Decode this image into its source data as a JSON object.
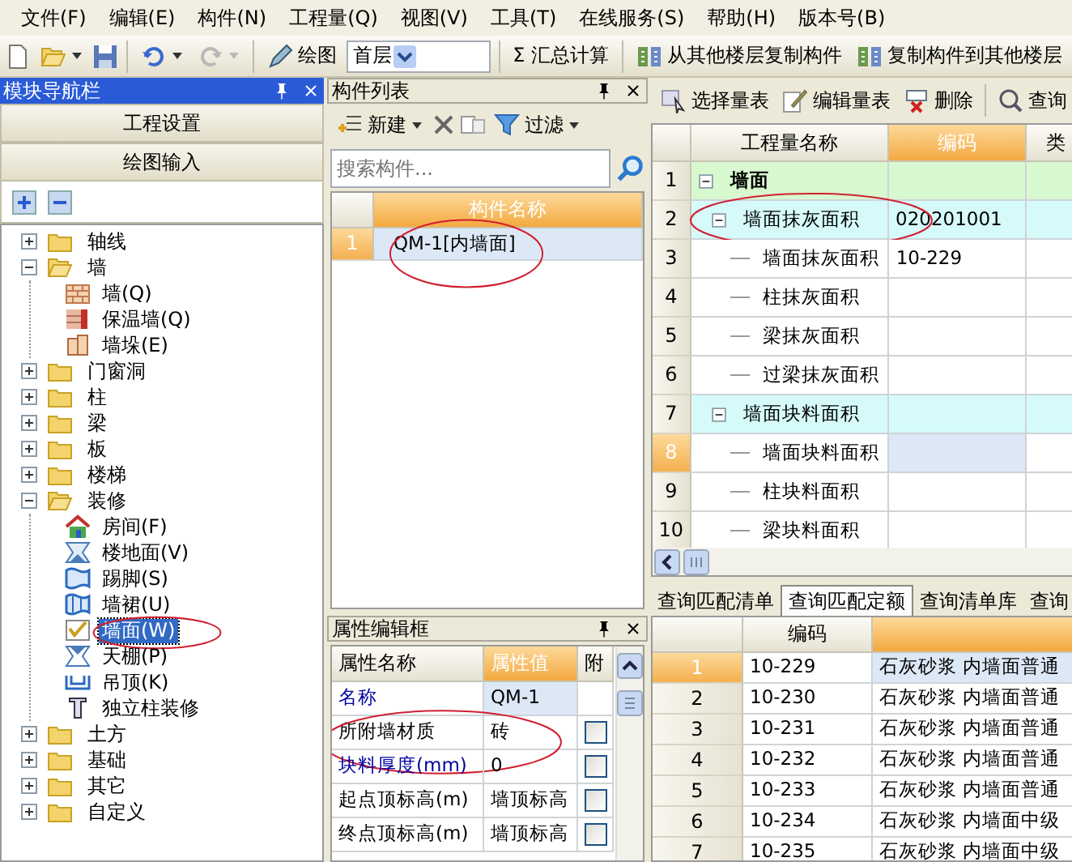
{
  "menu": [
    "文件(F)",
    "编辑(E)",
    "构件(N)",
    "工程量(Q)",
    "视图(V)",
    "工具(T)",
    "在线服务(S)",
    "帮助(H)",
    "版本号(B)"
  ],
  "toolbar": {
    "redo_disabled": true,
    "draw": "绘图",
    "floor": "首层",
    "sum_symbol": "Σ",
    "sum": "汇总计算",
    "copy_from": "从其他楼层复制构件",
    "copy_to": "复制构件到其他楼层"
  },
  "nav": {
    "title": "模块导航栏",
    "sections": [
      "工程设置",
      "绘图输入"
    ],
    "tree": [
      {
        "label": "轴线",
        "expanded": false
      },
      {
        "label": "墙",
        "expanded": true,
        "children": [
          {
            "label": "墙(Q)",
            "kind": "wall",
            "selected": false
          },
          {
            "label": "保温墙(Q)",
            "kind": "insulation",
            "selected": false
          },
          {
            "label": "墙垛(E)",
            "kind": "pier",
            "selected": false
          }
        ]
      },
      {
        "label": "门窗洞",
        "expanded": false
      },
      {
        "label": "柱",
        "expanded": false
      },
      {
        "label": "梁",
        "expanded": false
      },
      {
        "label": "板",
        "expanded": false
      },
      {
        "label": "楼梯",
        "expanded": false
      },
      {
        "label": "装修",
        "expanded": true,
        "children": [
          {
            "label": "房间(F)",
            "kind": "room",
            "selected": false
          },
          {
            "label": "楼地面(V)",
            "kind": "floor",
            "selected": false
          },
          {
            "label": "踢脚(S)",
            "kind": "skirting",
            "selected": false
          },
          {
            "label": "墙裙(U)",
            "kind": "dado",
            "selected": false
          },
          {
            "label": "墙面(W)",
            "kind": "wallface",
            "selected": true,
            "circled": true
          },
          {
            "label": "天棚(P)",
            "kind": "ceiling",
            "selected": false
          },
          {
            "label": "吊顶(K)",
            "kind": "suspended",
            "selected": false
          },
          {
            "label": "独立柱装修",
            "kind": "column",
            "selected": false
          }
        ]
      },
      {
        "label": "土方",
        "expanded": false
      },
      {
        "label": "基础",
        "expanded": false
      },
      {
        "label": "其它",
        "expanded": false
      },
      {
        "label": "自定义",
        "expanded": false
      }
    ]
  },
  "components": {
    "title": "构件列表",
    "new": "新建",
    "filter": "过滤",
    "search": {
      "placeholder": "搜索构件..."
    },
    "column": "构件名称",
    "rows": [
      {
        "index": "1",
        "name": "QM-1[内墙面]",
        "selected": true,
        "circled": true
      }
    ]
  },
  "properties": {
    "title": "属性编辑框",
    "columns": [
      "属性名称",
      "属性值",
      "附"
    ],
    "rows": [
      {
        "name": "名称",
        "value": "QM-1",
        "public": true,
        "selected": true
      },
      {
        "name": "所附墙材质",
        "value": "砖",
        "public": false,
        "selected": false,
        "checked": false,
        "circled": true
      },
      {
        "name": "块料厚度(mm)",
        "value": "0",
        "public": true,
        "selected": false,
        "checked": false
      },
      {
        "name": "起点顶标高(m)",
        "value": "墙顶标高",
        "public": false,
        "selected": false,
        "checked": false
      },
      {
        "name": "终点顶标高(m)",
        "value": "墙顶标高",
        "public": false,
        "selected": false,
        "checked": false
      }
    ]
  },
  "quantities": {
    "toolbar": [
      "选择量表",
      "编辑量表",
      "删除",
      "查询"
    ],
    "columns": [
      "工程量名称",
      "编码",
      "类"
    ],
    "rows": [
      {
        "index": "1",
        "name": "墙面",
        "kind": "group",
        "expanded": true,
        "selected": false,
        "children": [
          {
            "index": "2",
            "name": "墙面抹灰面积",
            "code": "020201001",
            "kind": "item",
            "expanded": true,
            "selected": false,
            "circled": true,
            "children": [
              {
                "index": "3",
                "name": "墙面抹灰面积",
                "code": "10-229",
                "kind": "quota",
                "selected": false
              },
              {
                "index": "4",
                "name": "柱抹灰面积",
                "kind": "quota",
                "selected": false
              },
              {
                "index": "5",
                "name": "梁抹灰面积",
                "kind": "quota",
                "selected": false
              },
              {
                "index": "6",
                "name": "过梁抹灰面积",
                "kind": "quota",
                "selected": false
              }
            ]
          },
          {
            "index": "7",
            "name": "墙面块料面积",
            "kind": "item",
            "expanded": true,
            "selected": false,
            "children": [
              {
                "index": "8",
                "name": "墙面块料面积",
                "kind": "quota",
                "selected": true
              },
              {
                "index": "9",
                "name": "柱块料面积",
                "kind": "quota",
                "selected": false
              },
              {
                "index": "10",
                "name": "梁块料面积",
                "kind": "quota",
                "selected": false
              }
            ]
          }
        ]
      }
    ]
  },
  "query": {
    "tabs": [
      {
        "label": "查询匹配清单",
        "selected": false
      },
      {
        "label": "查询匹配定额",
        "selected": true
      },
      {
        "label": "查询清单库",
        "selected": false
      },
      {
        "label": "查询",
        "selected": false
      }
    ],
    "columns": [
      "编码"
    ],
    "rows": [
      {
        "index": "1",
        "code": "10-229",
        "description": "石灰砂浆 内墙面普通",
        "selected": true
      },
      {
        "index": "2",
        "code": "10-230",
        "description": "石灰砂浆 内墙面普通",
        "selected": false
      },
      {
        "index": "3",
        "code": "10-231",
        "description": "石灰砂浆 内墙面普通",
        "selected": false
      },
      {
        "index": "4",
        "code": "10-232",
        "description": "石灰砂浆 内墙面普通",
        "selected": false
      },
      {
        "index": "5",
        "code": "10-233",
        "description": "石灰砂浆 内墙面普通",
        "selected": false
      },
      {
        "index": "6",
        "code": "10-234",
        "description": "石灰砂浆 内墙面中级",
        "selected": false
      },
      {
        "index": "7",
        "code": "10-235",
        "description": "石灰砂浆 内墙面中级",
        "selected": false
      }
    ]
  }
}
